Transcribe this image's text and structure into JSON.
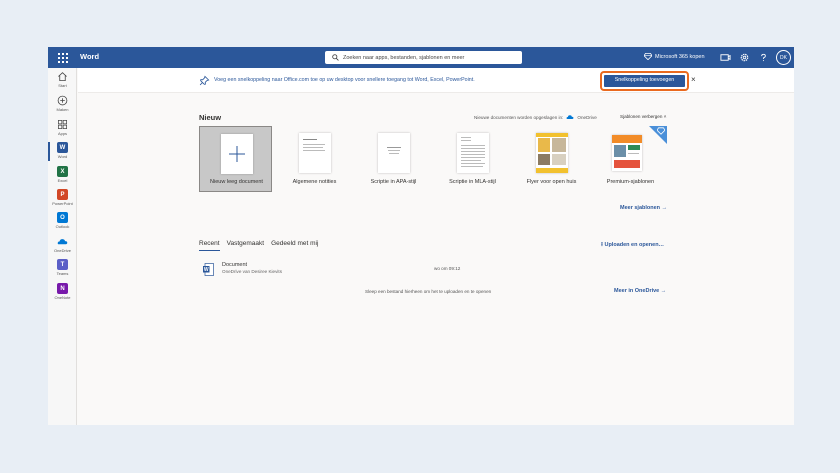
{
  "colors": {
    "accent": "#2b579a",
    "highlight": "#ea6a1f"
  },
  "topbar": {
    "app_name": "Word",
    "search_placeholder": "Zoeken naar apps, bestanden, sjablonen en meer",
    "buy_label": "Microsoft 365 kopen",
    "avatar_initials": "DK"
  },
  "sidebar": {
    "items": [
      {
        "label": "Start",
        "icon": "home-icon"
      },
      {
        "label": "Maken",
        "icon": "plus-circle-icon"
      },
      {
        "label": "Apps",
        "icon": "apps-icon"
      },
      {
        "label": "Word",
        "icon": "word-icon",
        "letter": "W",
        "color": "#2b579a"
      },
      {
        "label": "Excel",
        "icon": "excel-icon",
        "letter": "X",
        "color": "#217346"
      },
      {
        "label": "PowerPoint",
        "icon": "powerpoint-icon",
        "letter": "P",
        "color": "#d24726"
      },
      {
        "label": "Outlook",
        "icon": "outlook-icon",
        "letter": "O",
        "color": "#0078d4"
      },
      {
        "label": "OneDrive",
        "icon": "onedrive-icon"
      },
      {
        "label": "Teams",
        "icon": "teams-icon",
        "letter": "T",
        "color": "#5b5fc7"
      },
      {
        "label": "OneNote",
        "icon": "onenote-icon",
        "letter": "N",
        "color": "#7719aa"
      }
    ]
  },
  "banner": {
    "text": "Voeg een snelkoppeling naar Office.com toe op uw desktop voor snellere toegang tot Word, Excel, PowerPoint.",
    "button_label": "Snelkoppeling toevoegen",
    "close_label": "×"
  },
  "new_section": {
    "heading": "Nieuw",
    "save_note": "Nieuwe documenten worden opgeslagen in:",
    "save_location": "OneDrive",
    "hide_templates": "Sjablonen verbergen",
    "templates": [
      {
        "name": "Nieuw leeg document"
      },
      {
        "name": "Algemene notities"
      },
      {
        "name": "Scriptie in APA-stijl"
      },
      {
        "name": "Scriptie in MLA-stijl"
      },
      {
        "name": "Flyer voor open huis"
      },
      {
        "name": "Premium-sjablonen"
      }
    ],
    "more_templates": "Meer sjablonen →"
  },
  "recent_section": {
    "tabs": [
      "Recent",
      "Vastgemaakt",
      "Gedeeld met mij"
    ],
    "upload_label": "Uploaden en openen…",
    "documents": [
      {
        "name": "Document",
        "location": "OneDrive van Desiree Kievits",
        "time": "wo om 09:12"
      }
    ],
    "drop_hint": "Sleep een bestand hierheen om het te uploaden en te openen",
    "more_onedrive": "Meer in OneDrive →"
  }
}
